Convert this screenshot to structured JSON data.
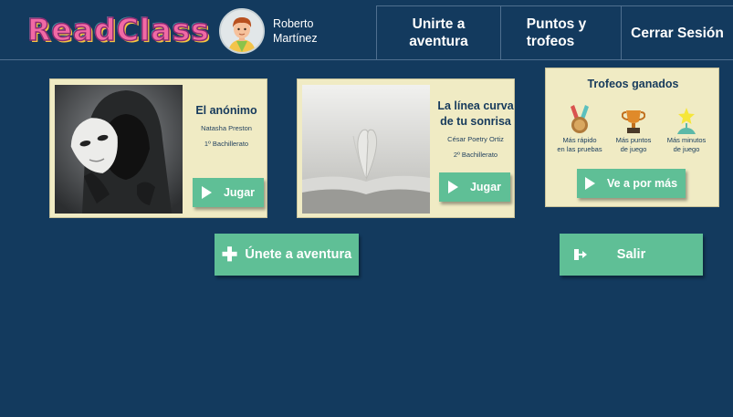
{
  "header": {
    "logo_text": "ReadClass",
    "user": {
      "first_name": "Roberto",
      "last_name": "Martínez"
    },
    "nav": [
      {
        "line1": "Unirte a",
        "line2": "aventura"
      },
      {
        "line1": "Puntos y",
        "line2": "trofeos"
      },
      {
        "line1": "Cerrar Sesión"
      }
    ]
  },
  "books": [
    {
      "title_line1": "El anónimo",
      "author": "Natasha Preston",
      "grade": "1º Bachillerato",
      "play_label": "Jugar"
    },
    {
      "title_line1": "La línea curva",
      "title_line2": "de tu sonrisa",
      "author": "César Poetry Ortiz",
      "grade": "2º Bachillerato",
      "play_label": "Jugar"
    }
  ],
  "trophies": {
    "title": "Trofeos ganados",
    "items": [
      {
        "line1": "Más rápido",
        "line2": "en las pruebas",
        "icon": "medal-icon"
      },
      {
        "line1": "Más puntos",
        "line2": "de juego",
        "icon": "trophy-cup-icon"
      },
      {
        "line1": "Más minutos",
        "line2": "de juego",
        "icon": "star-trophy-icon"
      }
    ],
    "more_label": "Ve a por más"
  },
  "actions": {
    "join_label": "Únete a aventura",
    "exit_label": "Salir"
  },
  "colors": {
    "background": "#133a5e",
    "card": "#f0ebc4",
    "button": "#5fbf96",
    "title_text": "#163a5c"
  }
}
